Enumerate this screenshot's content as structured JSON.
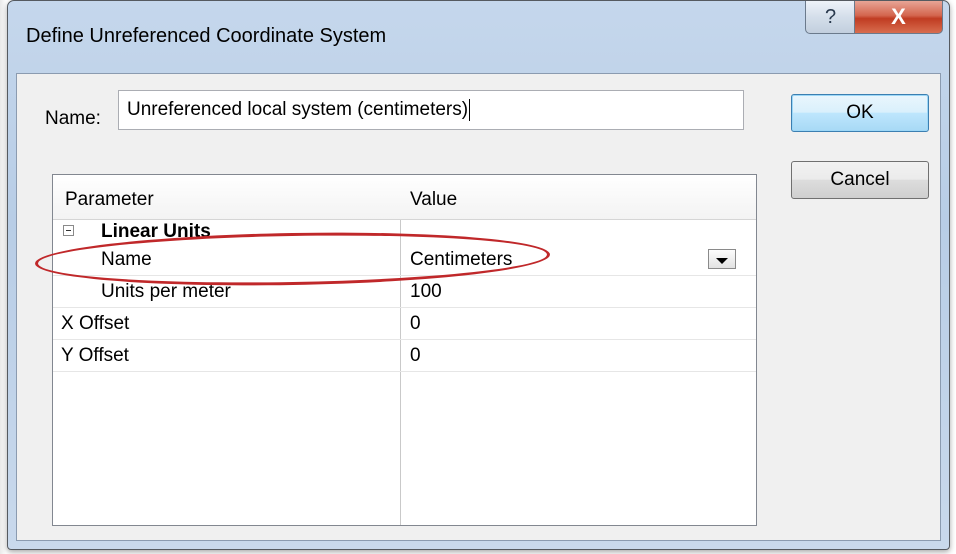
{
  "window": {
    "title": "Define Unreferenced Coordinate System",
    "help_glyph": "?",
    "close_glyph": "X"
  },
  "name_field": {
    "label": "Name:",
    "value": "Unreferenced local system (centimeters)"
  },
  "buttons": {
    "ok": "OK",
    "cancel": "Cancel"
  },
  "grid": {
    "headers": {
      "parameter": "Parameter",
      "value": "Value"
    },
    "group": {
      "title": "Linear Units",
      "expanded": true
    },
    "rows": [
      {
        "parameter": "Name",
        "value": "Centimeters",
        "has_dropdown": true
      },
      {
        "parameter": "Units per meter",
        "value": "100"
      },
      {
        "parameter": "X Offset",
        "value": "0"
      },
      {
        "parameter": "Y Offset",
        "value": "0"
      }
    ]
  },
  "colors": {
    "highlight_annotation": "#c0282a",
    "close_button": "#c9452a"
  }
}
